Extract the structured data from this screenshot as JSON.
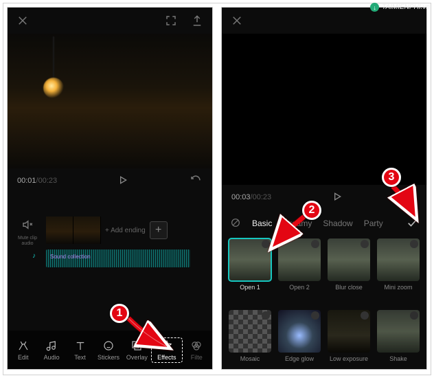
{
  "watermark": "TAIMIENPHI.vn",
  "left": {
    "time_current": "00:01",
    "time_total": "/00:23",
    "mute_label": "Mute clip audio",
    "add_ending": "+ Add ending",
    "audio_clip": "Sound collection",
    "toolbar": [
      {
        "key": "edit",
        "label": "Edit"
      },
      {
        "key": "audio",
        "label": "Audio"
      },
      {
        "key": "text",
        "label": "Text"
      },
      {
        "key": "stickers",
        "label": "Stickers"
      },
      {
        "key": "overlay",
        "label": "Overlay"
      },
      {
        "key": "effects",
        "label": "Effects"
      },
      {
        "key": "filters",
        "label": "Filte"
      }
    ]
  },
  "right": {
    "time_current": "00:03",
    "time_total": "/00:23",
    "categories": [
      "Basic",
      "Dreamy",
      "Shadow",
      "Party"
    ],
    "active_category": "Basic",
    "effects": [
      {
        "key": "open1",
        "label": "Open 1",
        "selected": true
      },
      {
        "key": "open2",
        "label": "Open 2"
      },
      {
        "key": "blurclose",
        "label": "Blur close"
      },
      {
        "key": "minizoom",
        "label": "Mini zoom"
      },
      {
        "key": "mosaic",
        "label": "Mosaic",
        "cls": "mosaic"
      },
      {
        "key": "edgeglow",
        "label": "Edge glow",
        "cls": "glow"
      },
      {
        "key": "lowexp",
        "label": "Low exposure",
        "cls": "dark"
      },
      {
        "key": "shake",
        "label": "Shake",
        "cls": "shake"
      }
    ]
  },
  "annotations": {
    "b1": "1",
    "b2": "2",
    "b3": "3"
  }
}
